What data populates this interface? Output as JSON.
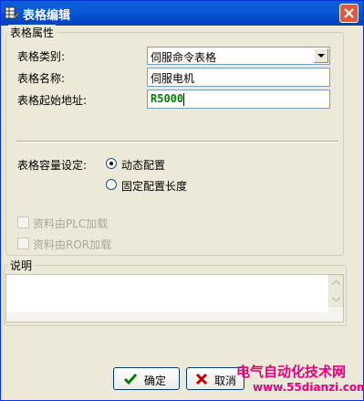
{
  "window": {
    "title": "表格编辑"
  },
  "properties": {
    "group_label": "表格属性",
    "type_label": "表格类别:",
    "type_value": "伺服命令表格",
    "name_label": "表格名称:",
    "name_value": "伺服电机",
    "addr_label": "表格起始地址:",
    "addr_value": "R5000",
    "capacity_label": "表格容量设定:",
    "capacity_options": [
      "动态配置",
      "固定配置长度"
    ],
    "capacity_selected": "动态配置",
    "plc_load_label": "资料由PLC加载",
    "plc_load_checked": false,
    "ror_load_label": "资料由ROR加载",
    "ror_load_checked": false
  },
  "description": {
    "group_label": "说明",
    "text": ""
  },
  "buttons": {
    "ok": "确定",
    "cancel": "取消"
  },
  "watermark": {
    "line1": "电气自动化技术网",
    "line2": "www.55dianzi.com"
  },
  "colors": {
    "titlebar": "#0a5fd8",
    "accent_green": "#008000",
    "watermark": "#e6007e"
  }
}
